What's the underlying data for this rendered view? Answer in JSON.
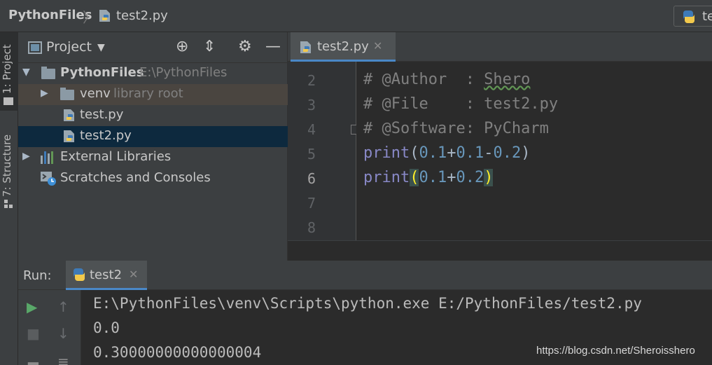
{
  "breadcrumb": {
    "root": "PythonFiles",
    "separator": "〉",
    "file": "test2.py"
  },
  "run_config": {
    "label": "te"
  },
  "tool_strip": {
    "project_tab": "1: Project",
    "structure_tab": "7: Structure"
  },
  "project_panel": {
    "title": "Project",
    "tree": [
      {
        "label": "PythonFiles",
        "hint": "E:\\PythonFiles"
      },
      {
        "label": "venv",
        "hint": "library root"
      },
      {
        "label": "test.py"
      },
      {
        "label": "test2.py"
      },
      {
        "label": "External Libraries"
      },
      {
        "label": "Scratches and Consoles"
      }
    ]
  },
  "editor": {
    "tab_label": "test2.py",
    "line_numbers": [
      "2",
      "3",
      "4",
      "5",
      "6",
      "7",
      "8"
    ],
    "current_line": "6",
    "code": {
      "line2_prefix": "# @Author  : ",
      "line2_author": "Shero",
      "line3": "# @File    : test2.py",
      "line4": "# @Software: PyCharm",
      "line5_func": "print",
      "line5_open": "(",
      "line5_n1": "0.1",
      "line5_op1": "+",
      "line5_n2": "0.1",
      "line5_op2": "-",
      "line5_n3": "0.2",
      "line5_close": ")",
      "line6_func": "print",
      "line6_open": "(",
      "line6_n1": "0.1",
      "line6_op1": "+",
      "line6_n2": "0.2",
      "line6_close": ")"
    }
  },
  "run_panel": {
    "title": "Run:",
    "tab_label": "test2",
    "console": [
      "E:\\PythonFiles\\venv\\Scripts\\python.exe E:/PythonFiles/test2.py",
      "0.0",
      "0.30000000000000004"
    ]
  },
  "watermark": "https://blog.csdn.net/Sheroisshero",
  "colors": {
    "accent": "#4a88c7",
    "selection": "#0d293e",
    "comment": "#808080",
    "number": "#6897bb",
    "builtin": "#8888c6"
  }
}
